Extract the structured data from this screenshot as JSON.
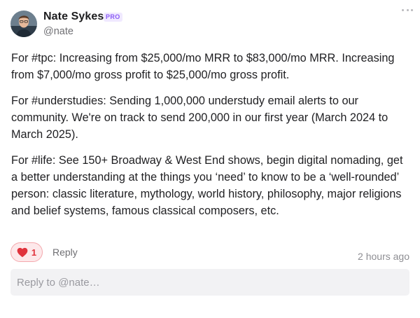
{
  "author": {
    "name": "Nate Sykes",
    "badge": "PRO",
    "handle": "@nate"
  },
  "post": {
    "paragraphs": [
      "For #tpc: Increasing from $25,000/mo MRR to $83,000/mo MRR. Increasing from $7,000/mo gross profit to $25,000/mo gross profit.",
      "For #understudies: Sending 1,000,000 understudy email alerts to our community. We're on track to send 200,000 in our first year (March 2024 to March 2025).",
      "For #life: See 150+ Broadway & West End shows, begin digital nomading, get a better understanding at the things you ‘need’ to know to be a ‘well-rounded’ person: classic literature, mythology, world history, philosophy, major religions and belief systems, famous classical composers, etc."
    ]
  },
  "actions": {
    "like_count": "1",
    "reply_label": "Reply",
    "timestamp": "2 hours ago"
  },
  "reply_box": {
    "placeholder": "Reply to @nate…"
  },
  "icons": {
    "more": "more-dots-icon",
    "like": "heart-icon"
  },
  "colors": {
    "like_accent": "#e0323c",
    "like_bg": "#fde8ea",
    "badge": "#8b5cf6"
  }
}
